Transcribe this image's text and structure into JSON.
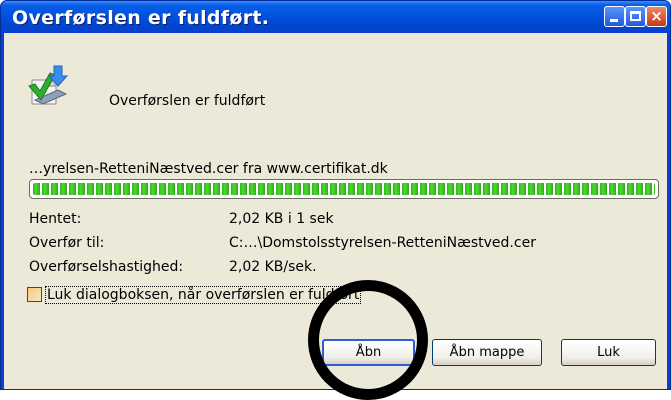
{
  "window": {
    "title": "Overførslen er fuldført."
  },
  "header": {
    "icon": "download-complete-icon",
    "text": "Overførslen er fuldført"
  },
  "download": {
    "source": "…yrelsen-RetteniNæstved.cer fra www.certifikat.dk",
    "progress": 1.0
  },
  "details": {
    "downloaded_label": "Hentet:",
    "downloaded_value": "2,02 KB i 1 sek",
    "target_label": "Overfør til:",
    "target_value": "C:…\\Domstolsstyrelsen-RetteniNæstved.cer",
    "rate_label": "Overførselshastighed:",
    "rate_value": "2,02 KB/sek."
  },
  "options": {
    "close_on_complete_label": "Luk dialogboksen, når overførslen er fuldført",
    "close_on_complete_checked": false
  },
  "buttons": {
    "open": "Åbn",
    "open_folder": "Åbn mappe",
    "close": "Luk"
  },
  "colors": {
    "title_bar": "#0a5fe6",
    "dialog_background": "#ece9d8",
    "progress_fill": "#3cc428",
    "annotation": "#000000"
  }
}
